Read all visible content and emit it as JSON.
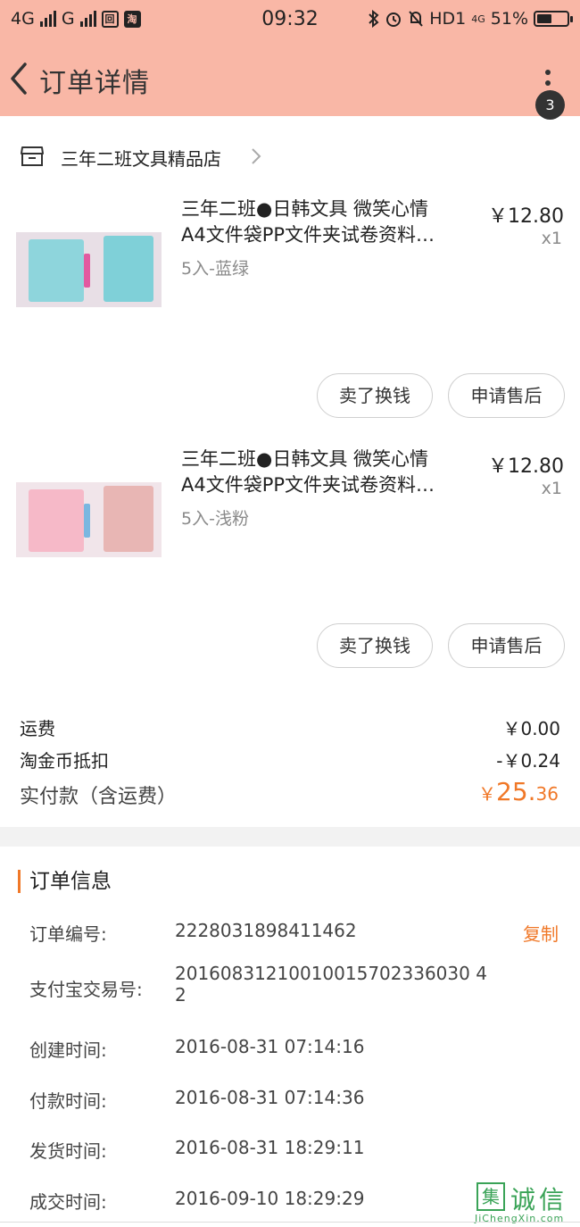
{
  "status_bar": {
    "network_left": "4G",
    "network_mid": "G",
    "time": "09:32",
    "hd": "HD1",
    "network_right": "4G",
    "battery_text": "51%",
    "battery_level": 0.51
  },
  "header": {
    "title": "订单详情",
    "badge_count": "3"
  },
  "shop": {
    "name": "三年二班文具精品店"
  },
  "items": [
    {
      "title_line1": "三年二班●日韩文具 微笑心情",
      "title_line2": "A4文件袋PP文件夹试卷资料…",
      "variant": "5入-蓝绿",
      "price": "￥12.80",
      "qty": "x1",
      "sell_label": "卖了换钱",
      "after_sale_label": "申请售后",
      "thumb_colors": {
        "bg": "#e8dfe6",
        "a": "#8ed5dc",
        "b": "#7fd0d8",
        "tab": "#e25aa0"
      }
    },
    {
      "title_line1": "三年二班●日韩文具 微笑心情",
      "title_line2": "A4文件袋PP文件夹试卷资料…",
      "variant": "5入-浅粉",
      "price": "￥12.80",
      "qty": "x1",
      "sell_label": "卖了换钱",
      "after_sale_label": "申请售后",
      "thumb_colors": {
        "bg": "#f1e5ea",
        "a": "#f6b9c8",
        "b": "#e8b6b4",
        "tab": "#7ab7e0"
      }
    }
  ],
  "summary": {
    "shipping_label": "运费",
    "shipping_value": "￥0.00",
    "coin_label": "淘金币抵扣",
    "coin_value": "-￥0.24",
    "total_label": "实付款（含运费）",
    "total_currency": "￥",
    "total_int": "25.",
    "total_dec": "36"
  },
  "order_info": {
    "heading": "订单信息",
    "copy_label": "复制",
    "rows": [
      {
        "label": "订单编号:",
        "value": "2228031898411462"
      },
      {
        "label": "支付宝交易号:",
        "value": "20160831210010015702336030 42"
      },
      {
        "label": "创建时间:",
        "value": "2016-08-31 07:14:16"
      },
      {
        "label": "付款时间:",
        "value": "2016-08-31 07:14:36"
      },
      {
        "label": "发货时间:",
        "value": "2016-08-31 18:29:11"
      },
      {
        "label": "成交时间:",
        "value": "2016-09-10 18:29:29"
      }
    ]
  },
  "watermark": {
    "box": "集",
    "text": "诚信",
    "sub": "JiChengXin.com"
  },
  "colors": {
    "header_bg": "#f9b7a6",
    "accent": "#f07828"
  }
}
